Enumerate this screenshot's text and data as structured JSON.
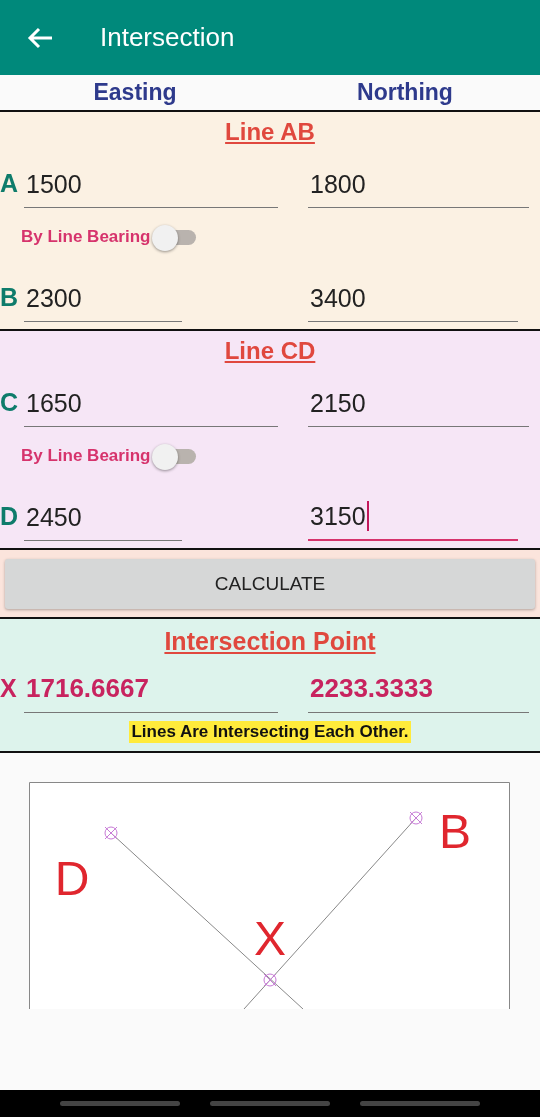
{
  "app_bar": {
    "title": "Intersection"
  },
  "columns": [
    "Easting",
    "Northing"
  ],
  "sections": [
    {
      "title": "Line AB",
      "rows": [
        {
          "point": "A",
          "easting": {
            "value": "1500",
            "focused": false
          },
          "northing": {
            "value": "1800",
            "focused": false
          }
        },
        {
          "point": "B",
          "easting": {
            "value": "2300",
            "focused": false
          },
          "northing": {
            "value": "3400",
            "focused": false
          }
        }
      ],
      "toggle": {
        "label": "By Line Bearing",
        "on": false
      }
    },
    {
      "title": "Line CD",
      "rows": [
        {
          "point": "C",
          "easting": {
            "value": "1650",
            "focused": false
          },
          "northing": {
            "value": "2150",
            "focused": false
          }
        },
        {
          "point": "D",
          "easting": {
            "value": "2450",
            "focused": false
          },
          "northing": {
            "value": "3150",
            "focused": true
          }
        }
      ],
      "toggle": {
        "label": "By Line Bearing",
        "on": false
      }
    }
  ],
  "calculate_button": "CALCULATE",
  "result": {
    "title": "Intersection Point",
    "point": "X",
    "easting": "1716.6667",
    "northing": "2233.3333",
    "message": "Lines Are Intersecting Each Other."
  },
  "plot": {
    "labels": [
      {
        "text": "D"
      },
      {
        "text": "B"
      },
      {
        "text": "X"
      }
    ]
  }
}
